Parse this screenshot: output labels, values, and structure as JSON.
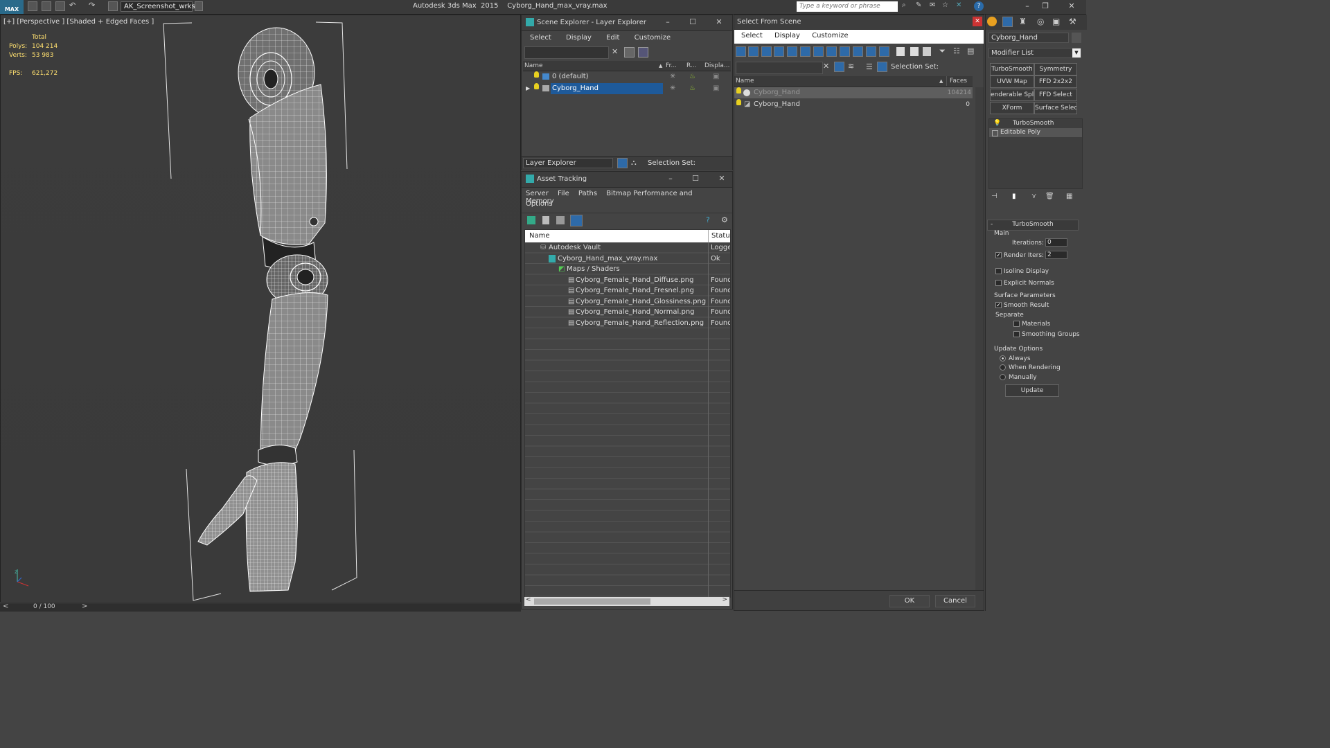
{
  "app": {
    "workspace": "AK_Screenshot_wrksp",
    "title": "Autodesk 3ds Max  2015    Cyborg_Hand_max_vray.max",
    "search_placeholder": "Type a keyword or phrase"
  },
  "viewport": {
    "label": "[+] [Perspective ] [Shaded + Edged Faces ]",
    "stats": {
      "total_label": "Total",
      "polys_label": "Polys:",
      "polys": "104 214",
      "verts_label": "Verts:",
      "verts": "53 983",
      "fps_label": "FPS:",
      "fps": "621,272"
    },
    "timeline": "0 / 100"
  },
  "scene_explorer": {
    "title": "Scene Explorer - Layer Explorer",
    "menu": [
      "Select",
      "Display",
      "Edit",
      "Customize"
    ],
    "columns": [
      "Name",
      "Fr...",
      "R...",
      "Displa..."
    ],
    "rows": [
      {
        "name": "0 (default)"
      },
      {
        "name": "Cyborg_Hand"
      }
    ],
    "footer_dropdown": "Layer Explorer",
    "selection_set_label": "Selection Set:"
  },
  "asset_tracking": {
    "title": "Asset Tracking",
    "menu": [
      "Server",
      "File",
      "Paths",
      "Bitmap Performance and Memory"
    ],
    "menu2": "Options",
    "columns": [
      "Name",
      "Status"
    ],
    "rows": [
      {
        "name": "Autodesk Vault",
        "status": "Logged"
      },
      {
        "name": "Cyborg_Hand_max_vray.max",
        "status": "Ok"
      },
      {
        "name": "Maps / Shaders",
        "status": ""
      },
      {
        "name": "Cyborg_Female_Hand_Diffuse.png",
        "status": "Found"
      },
      {
        "name": "Cyborg_Female_Hand_Fresnel.png",
        "status": "Found"
      },
      {
        "name": "Cyborg_Female_Hand_Glossiness.png",
        "status": "Found"
      },
      {
        "name": "Cyborg_Female_Hand_Normal.png",
        "status": "Found"
      },
      {
        "name": "Cyborg_Female_Hand_Reflection.png",
        "status": "Found"
      }
    ]
  },
  "select_from_scene": {
    "title": "Select From Scene",
    "menu": [
      "Select",
      "Display",
      "Customize"
    ],
    "selection_set_label": "Selection Set:",
    "columns": [
      "Name",
      "Faces"
    ],
    "rows": [
      {
        "name": "Cyborg_Hand",
        "faces": "104214"
      },
      {
        "name": "Cyborg_Hand",
        "faces": "0"
      }
    ],
    "ok": "OK",
    "cancel": "Cancel"
  },
  "command_panel": {
    "object_name": "Cyborg_Hand",
    "modifier_list": "Modifier List",
    "buttons": [
      "TurboSmooth",
      "Symmetry",
      "UVW Map",
      "FFD 2x2x2",
      "enderable Splir",
      "FFD Select",
      "XForm",
      "Surface Select"
    ],
    "stack": [
      "TurboSmooth",
      "Editable Poly"
    ],
    "rollout_title": "TurboSmooth",
    "main_label": "Main",
    "iterations_label": "Iterations:",
    "iterations": "0",
    "render_iters_label": "Render Iters:",
    "render_iters": "2",
    "isoline": "Isoline Display",
    "explicit_normals": "Explicit Normals",
    "surface_params": "Surface Parameters",
    "smooth_result": "Smooth Result",
    "separate": "Separate",
    "materials": "Materials",
    "smoothing_groups": "Smoothing Groups",
    "update_options": "Update Options",
    "always": "Always",
    "when_rendering": "When Rendering",
    "manually": "Manually",
    "update": "Update"
  }
}
